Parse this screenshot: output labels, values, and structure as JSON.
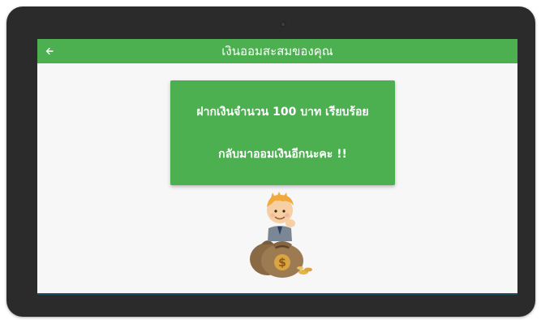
{
  "app": {
    "title": "เงินออมสะสมของคุณ",
    "back_icon": "arrow-left-icon",
    "colors": {
      "accent": "#4caf50",
      "background": "#f7f7f7",
      "text_on_accent": "#ffffff"
    }
  },
  "card": {
    "line1": "ฝากเงินจำนวน 100 บาท เรียบร้อย",
    "line2": "กลับมาออมเงินอีกนะคะ !!"
  },
  "illustration": {
    "icon": "boy-with-money-bags-icon"
  }
}
